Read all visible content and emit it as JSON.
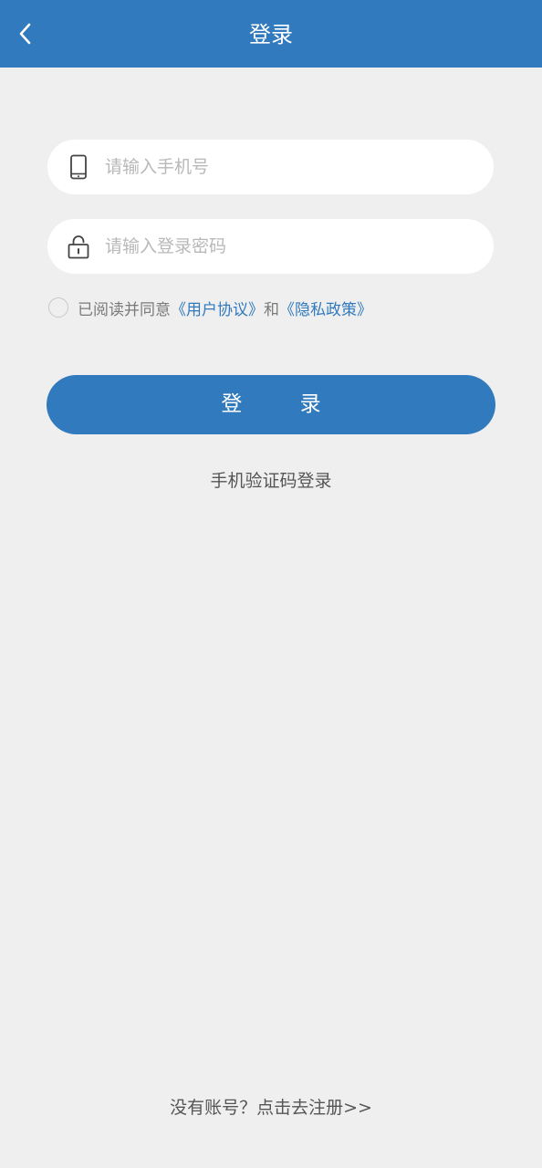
{
  "header": {
    "title": "登录",
    "back_icon": "chevron-left-icon",
    "color": "#317abd"
  },
  "form": {
    "phone": {
      "icon": "mobile-phone-icon",
      "placeholder": "请输入手机号",
      "value": ""
    },
    "password": {
      "icon": "lock-icon",
      "placeholder": "请输入登录密码",
      "value": ""
    }
  },
  "agreement": {
    "checked": false,
    "prefix": "已阅读并同意",
    "user_agreement": "《用户协议》",
    "conjunction": "和",
    "privacy_policy": "《隐私政策》"
  },
  "login_button_label": "登 录",
  "sms_login_label": "手机验证码登录",
  "register_label": "没有账号？点击去注册>>"
}
